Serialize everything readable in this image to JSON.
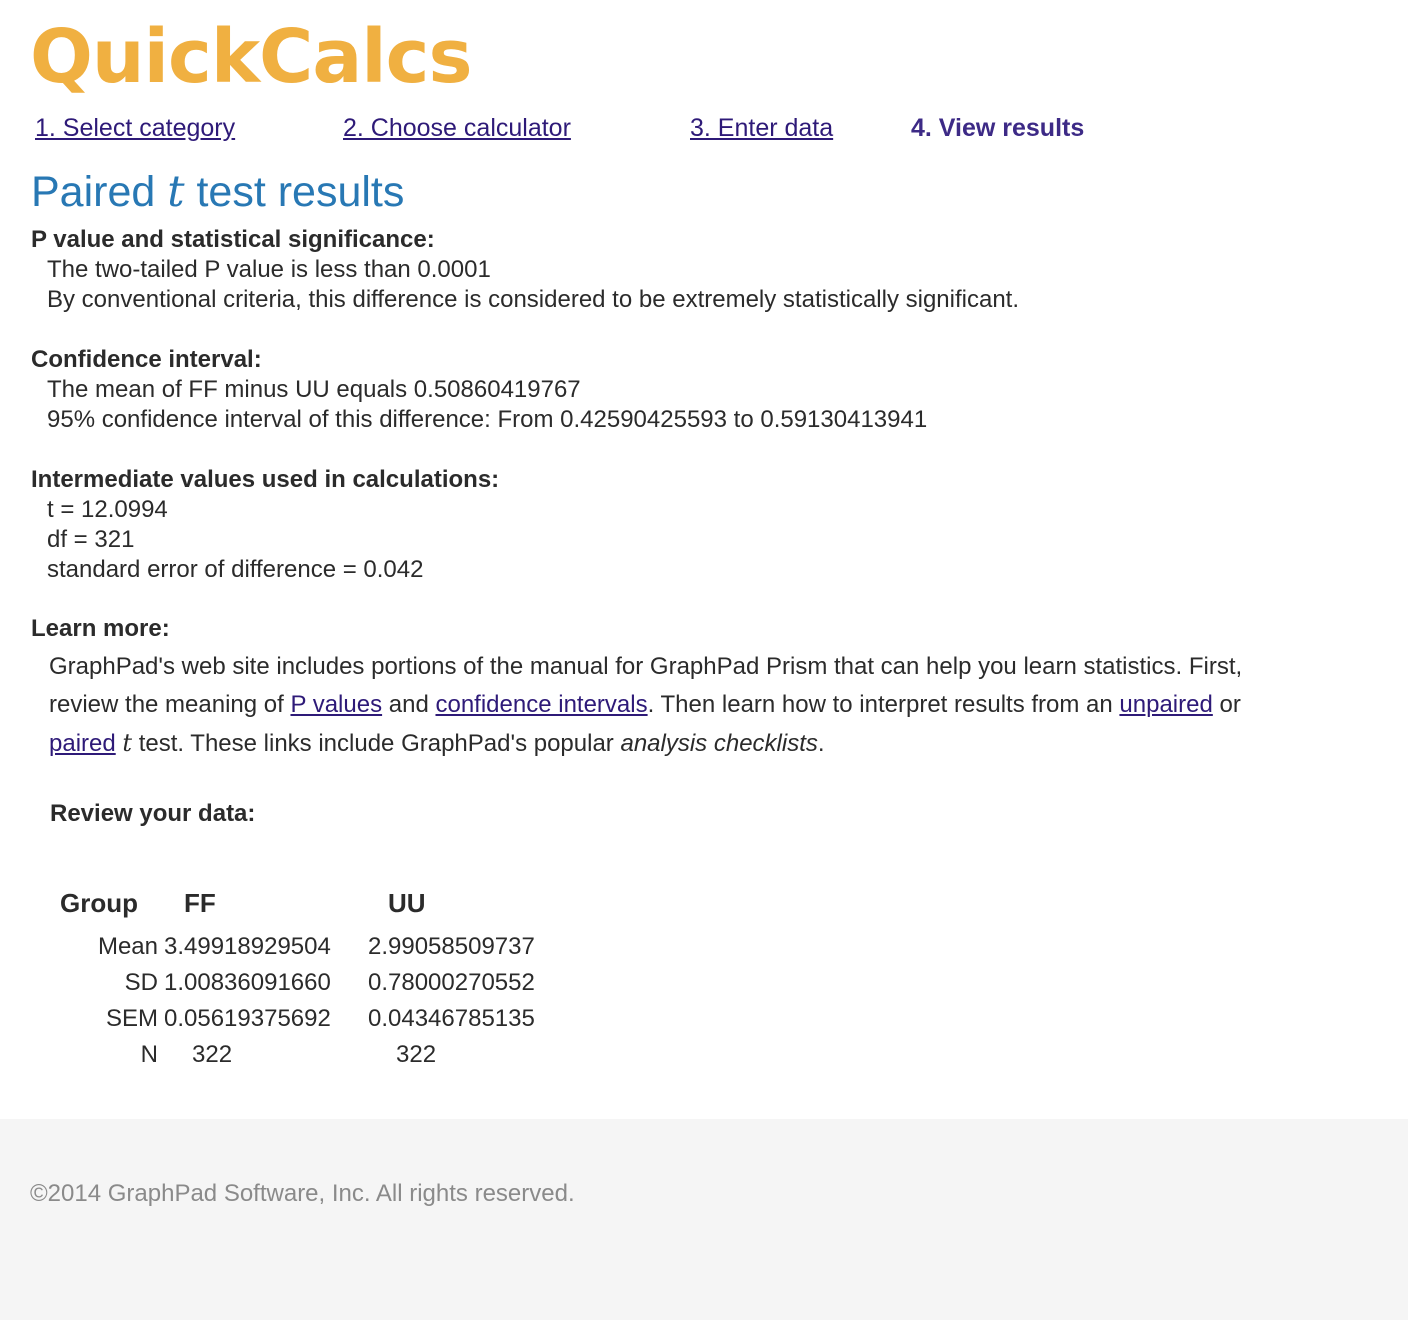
{
  "logo": "QuickCalcs",
  "steps": [
    {
      "label": "1. Select category"
    },
    {
      "label": "2. Choose calculator"
    },
    {
      "label": "3. Enter data"
    },
    {
      "label": "4. View results"
    }
  ],
  "title": {
    "prefix": "Paired ",
    "italic": "t",
    "suffix": " test results"
  },
  "sections": {
    "pvalue": {
      "heading": "P value and statistical significance:",
      "lines": [
        "The two-tailed P value is less than 0.0001",
        "By conventional criteria, this difference is considered to be extremely statistically significant."
      ]
    },
    "ci": {
      "heading": "Confidence interval:",
      "lines": [
        "The mean of FF minus UU equals 0.50860419767",
        "95% confidence interval of this difference: From 0.42590425593 to 0.59130413941"
      ]
    },
    "intermediate": {
      "heading": "Intermediate values used in calculations:",
      "lines": [
        "t = 12.0994",
        "df = 321",
        "standard error of difference = 0.042"
      ]
    }
  },
  "learn": {
    "heading": "Learn more:",
    "text1": "GraphPad's web site includes portions of the manual for GraphPad Prism that can help you learn statistics. First, review the meaning of ",
    "link_pvalues": "P values",
    "text2": " and ",
    "link_ci": "confidence intervals",
    "text3": ". Then learn how to interpret results from an ",
    "link_unpaired": "unpaired",
    "text4": " or ",
    "link_paired": "paired",
    "text5": " ",
    "t_italic": "t",
    "text6": " test. These links include GraphPad's popular ",
    "checklists": "analysis checklists",
    "text7": "."
  },
  "review": {
    "heading": "Review your data:",
    "columns": [
      "Group",
      "FF",
      "UU"
    ],
    "rows": [
      {
        "label": "Mean",
        "ff": "3.49918929504",
        "uu": "2.99058509737"
      },
      {
        "label": "SD",
        "ff": "1.00836091660",
        "uu": "0.78000270552"
      },
      {
        "label": "SEM",
        "ff": "0.05619375692",
        "uu": "0.04346785135"
      },
      {
        "label": "N",
        "ff": "322",
        "uu": "322"
      }
    ]
  },
  "footer": {
    "copyright": "©2014 GraphPad Software, Inc. All rights reserved."
  },
  "colors": {
    "logo": "#f0b041",
    "title": "#2878b4",
    "link": "#2e1a78",
    "footer_bg": "#f5f5f5"
  }
}
